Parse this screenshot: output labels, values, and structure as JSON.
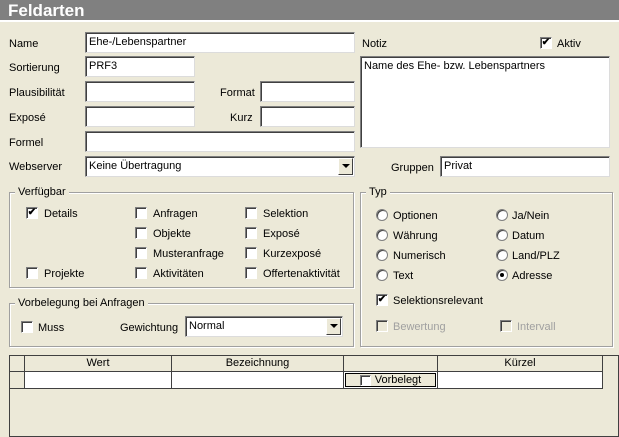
{
  "window": {
    "title": "Feldarten"
  },
  "form": {
    "name": {
      "label": "Name",
      "value": "Ehe-/Lebenspartner"
    },
    "sortierung": {
      "label": "Sortierung",
      "value": "PRF3"
    },
    "plausibilitaet": {
      "label": "Plausibilität",
      "value": ""
    },
    "format": {
      "label": "Format",
      "value": ""
    },
    "expose": {
      "label": "Exposé",
      "value": ""
    },
    "kurz": {
      "label": "Kurz",
      "value": ""
    },
    "formel": {
      "label": "Formel",
      "value": ""
    },
    "webserver": {
      "label": "Webserver",
      "value": "Keine Übertragung"
    },
    "notiz": {
      "label": "Notiz",
      "value": "Name des Ehe- bzw. Lebenspartners"
    },
    "aktiv": {
      "label": "Aktiv",
      "checked": true
    },
    "gruppen": {
      "label": "Gruppen",
      "value": "Privat"
    }
  },
  "verfuegbar": {
    "title": "Verfügbar",
    "items": [
      {
        "label": "Details",
        "checked": true
      },
      {
        "label": "Anfragen",
        "checked": false
      },
      {
        "label": "Selektion",
        "checked": false
      },
      {
        "label": "Objekte",
        "checked": false
      },
      {
        "label": "Exposé",
        "checked": false
      },
      {
        "label": "Musteranfrage",
        "checked": false
      },
      {
        "label": "Kurzexposé",
        "checked": false
      },
      {
        "label": "Projekte",
        "checked": false
      },
      {
        "label": "Aktivitäten",
        "checked": false
      },
      {
        "label": "Offertenaktivität",
        "checked": false
      }
    ]
  },
  "vorbelegung": {
    "title": "Vorbelegung bei Anfragen",
    "muss": {
      "label": "Muss",
      "checked": false
    },
    "gewichtung": {
      "label": "Gewichtung",
      "value": "Normal"
    }
  },
  "typ": {
    "title": "Typ",
    "options": [
      {
        "label": "Optionen",
        "selected": false
      },
      {
        "label": "Ja/Nein",
        "selected": false
      },
      {
        "label": "Währung",
        "selected": false
      },
      {
        "label": "Datum",
        "selected": false
      },
      {
        "label": "Numerisch",
        "selected": false
      },
      {
        "label": "Land/PLZ",
        "selected": false
      },
      {
        "label": "Text",
        "selected": false
      },
      {
        "label": "Adresse",
        "selected": true
      }
    ],
    "selektionsrelevant": {
      "label": "Selektionsrelevant",
      "checked": true
    },
    "bewertung": {
      "label": "Bewertung",
      "checked": false
    },
    "intervall": {
      "label": "Intervall",
      "checked": false
    }
  },
  "grid": {
    "columns": [
      "Wert",
      "Bezeichnung",
      "",
      "Kürzel"
    ],
    "row": {
      "vorbelegt_label": "Vorbelegt"
    }
  },
  "icons": {
    "check": "✔",
    "dropdown": "chevron-down-icon"
  },
  "colors": {
    "titlebar": "#808080",
    "background": "#ece9d8"
  }
}
